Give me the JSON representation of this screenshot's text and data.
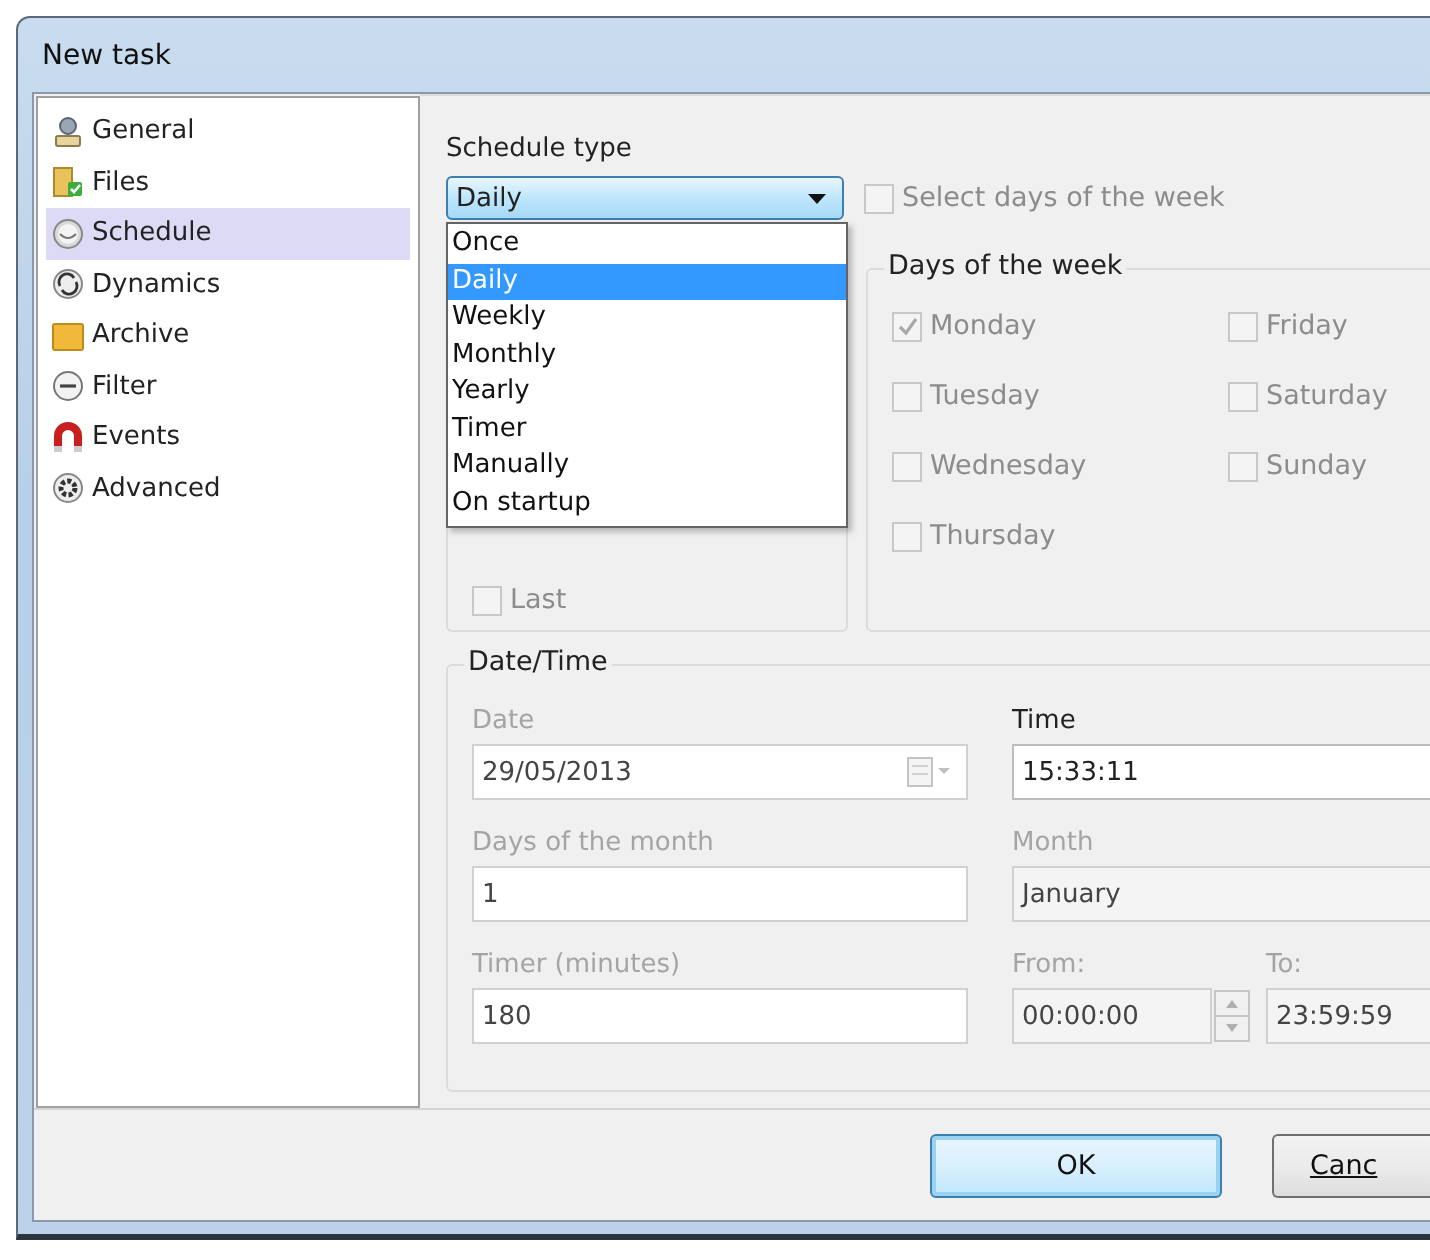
{
  "window": {
    "title": "New task"
  },
  "sidebar": {
    "items": [
      {
        "label": "General",
        "selected": false
      },
      {
        "label": "Files",
        "selected": false
      },
      {
        "label": "Schedule",
        "selected": true
      },
      {
        "label": "Dynamics",
        "selected": false
      },
      {
        "label": "Archive",
        "selected": false
      },
      {
        "label": "Filter",
        "selected": false
      },
      {
        "label": "Events",
        "selected": false
      },
      {
        "label": "Advanced",
        "selected": false
      }
    ]
  },
  "schedule_type": {
    "label": "Schedule type",
    "value": "Daily",
    "expanded": true,
    "options": [
      {
        "label": "Once",
        "selected": false
      },
      {
        "label": "Daily",
        "selected": true
      },
      {
        "label": "Weekly",
        "selected": false
      },
      {
        "label": "Monthly",
        "selected": false
      },
      {
        "label": "Yearly",
        "selected": false
      },
      {
        "label": "Timer",
        "selected": false
      },
      {
        "label": "Manually",
        "selected": false
      },
      {
        "label": "On startup",
        "selected": false
      }
    ]
  },
  "select_days_checkbox": {
    "label": "Select days of the week",
    "checked": false,
    "disabled": true
  },
  "weeks_of_month": [
    {
      "label": "Last",
      "checked": false,
      "disabled": true
    }
  ],
  "days_of_week": {
    "title": "Days of the week",
    "days": [
      {
        "label": "Monday",
        "checked": true,
        "disabled": true
      },
      {
        "label": "Friday",
        "checked": false,
        "disabled": true
      },
      {
        "label": "Tuesday",
        "checked": false,
        "disabled": true
      },
      {
        "label": "Saturday",
        "checked": false,
        "disabled": true
      },
      {
        "label": "Wednesday",
        "checked": false,
        "disabled": true
      },
      {
        "label": "Sunday",
        "checked": false,
        "disabled": true
      },
      {
        "label": "Thursday",
        "checked": false,
        "disabled": true
      }
    ]
  },
  "date_time": {
    "title": "Date/Time",
    "date": {
      "label": "Date",
      "value": "29/05/2013",
      "disabled": true
    },
    "time": {
      "label": "Time",
      "value": "15:33:11",
      "disabled": false
    },
    "days_of_month": {
      "label": "Days of the month",
      "value": "1",
      "disabled": true
    },
    "month": {
      "label": "Month",
      "value": "January",
      "disabled": true
    },
    "timer": {
      "label": "Timer (minutes)",
      "value": "180",
      "disabled": true
    },
    "from": {
      "label": "From:",
      "value": "00:00:00",
      "disabled": true
    },
    "to": {
      "label": "To:",
      "value": "23:59:59",
      "disabled": true
    }
  },
  "buttons": [
    {
      "label": "OK",
      "default": true
    },
    {
      "label": "Canc",
      "default": false
    }
  ]
}
